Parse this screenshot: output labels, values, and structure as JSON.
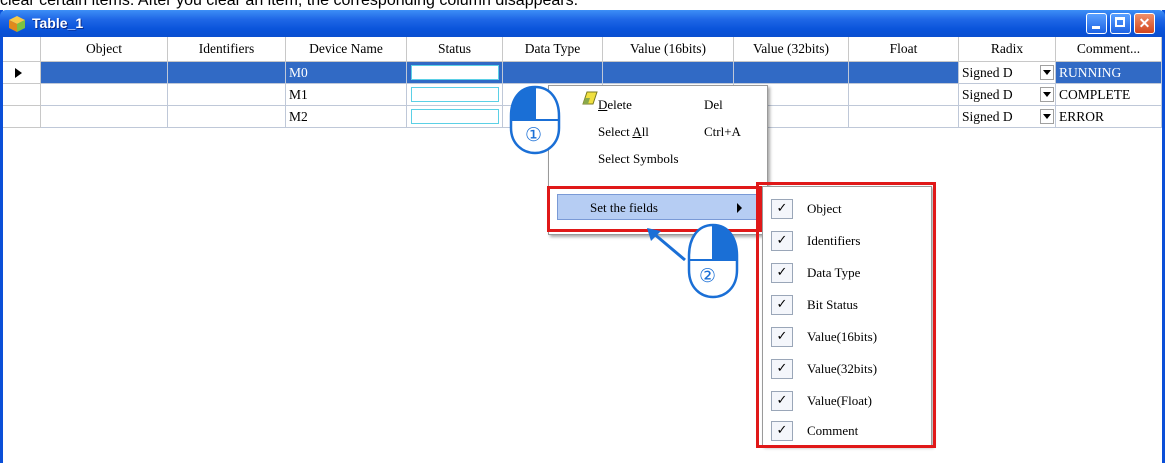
{
  "caption": "clear certain items. After you clear an item, the corresponding column disappears.",
  "window": {
    "title": "Table_1"
  },
  "table": {
    "columns": [
      "Object",
      "Identifiers",
      "Device Name",
      "Status",
      "Data Type",
      "Value (16bits)",
      "Value (32bits)",
      "Float",
      "Radix",
      "Comment..."
    ],
    "rows": [
      {
        "device": "M0",
        "radix": "Signed D",
        "comment": "RUNNING"
      },
      {
        "device": "M1",
        "radix": "Signed D",
        "comment": "COMPLETE"
      },
      {
        "device": "M2",
        "radix": "Signed D",
        "comment": "ERROR"
      }
    ]
  },
  "context_menu": {
    "items": [
      {
        "label": "Delete",
        "shortcut": "Del"
      },
      {
        "label": "Select All",
        "shortcut": "Ctrl+A"
      },
      {
        "label": "Select Symbols",
        "shortcut": ""
      },
      {
        "label": "Set the fields",
        "shortcut": ""
      }
    ]
  },
  "fields_submenu": {
    "items": [
      {
        "label": "Object",
        "checked": true
      },
      {
        "label": "Identifiers",
        "checked": true
      },
      {
        "label": "Data Type",
        "checked": true
      },
      {
        "label": "Bit Status",
        "checked": true
      },
      {
        "label": "Value(16bits)",
        "checked": true
      },
      {
        "label": "Value(32bits)",
        "checked": true
      },
      {
        "label": "Value(Float)",
        "checked": true
      },
      {
        "label": "Comment",
        "checked": true
      }
    ],
    "check_mark": "✓"
  },
  "callouts": {
    "step1": "①",
    "step2": "②"
  },
  "colors": {
    "selection": "#316ac5",
    "highlight_box": "#e01818",
    "callout": "#1a6fd6"
  }
}
